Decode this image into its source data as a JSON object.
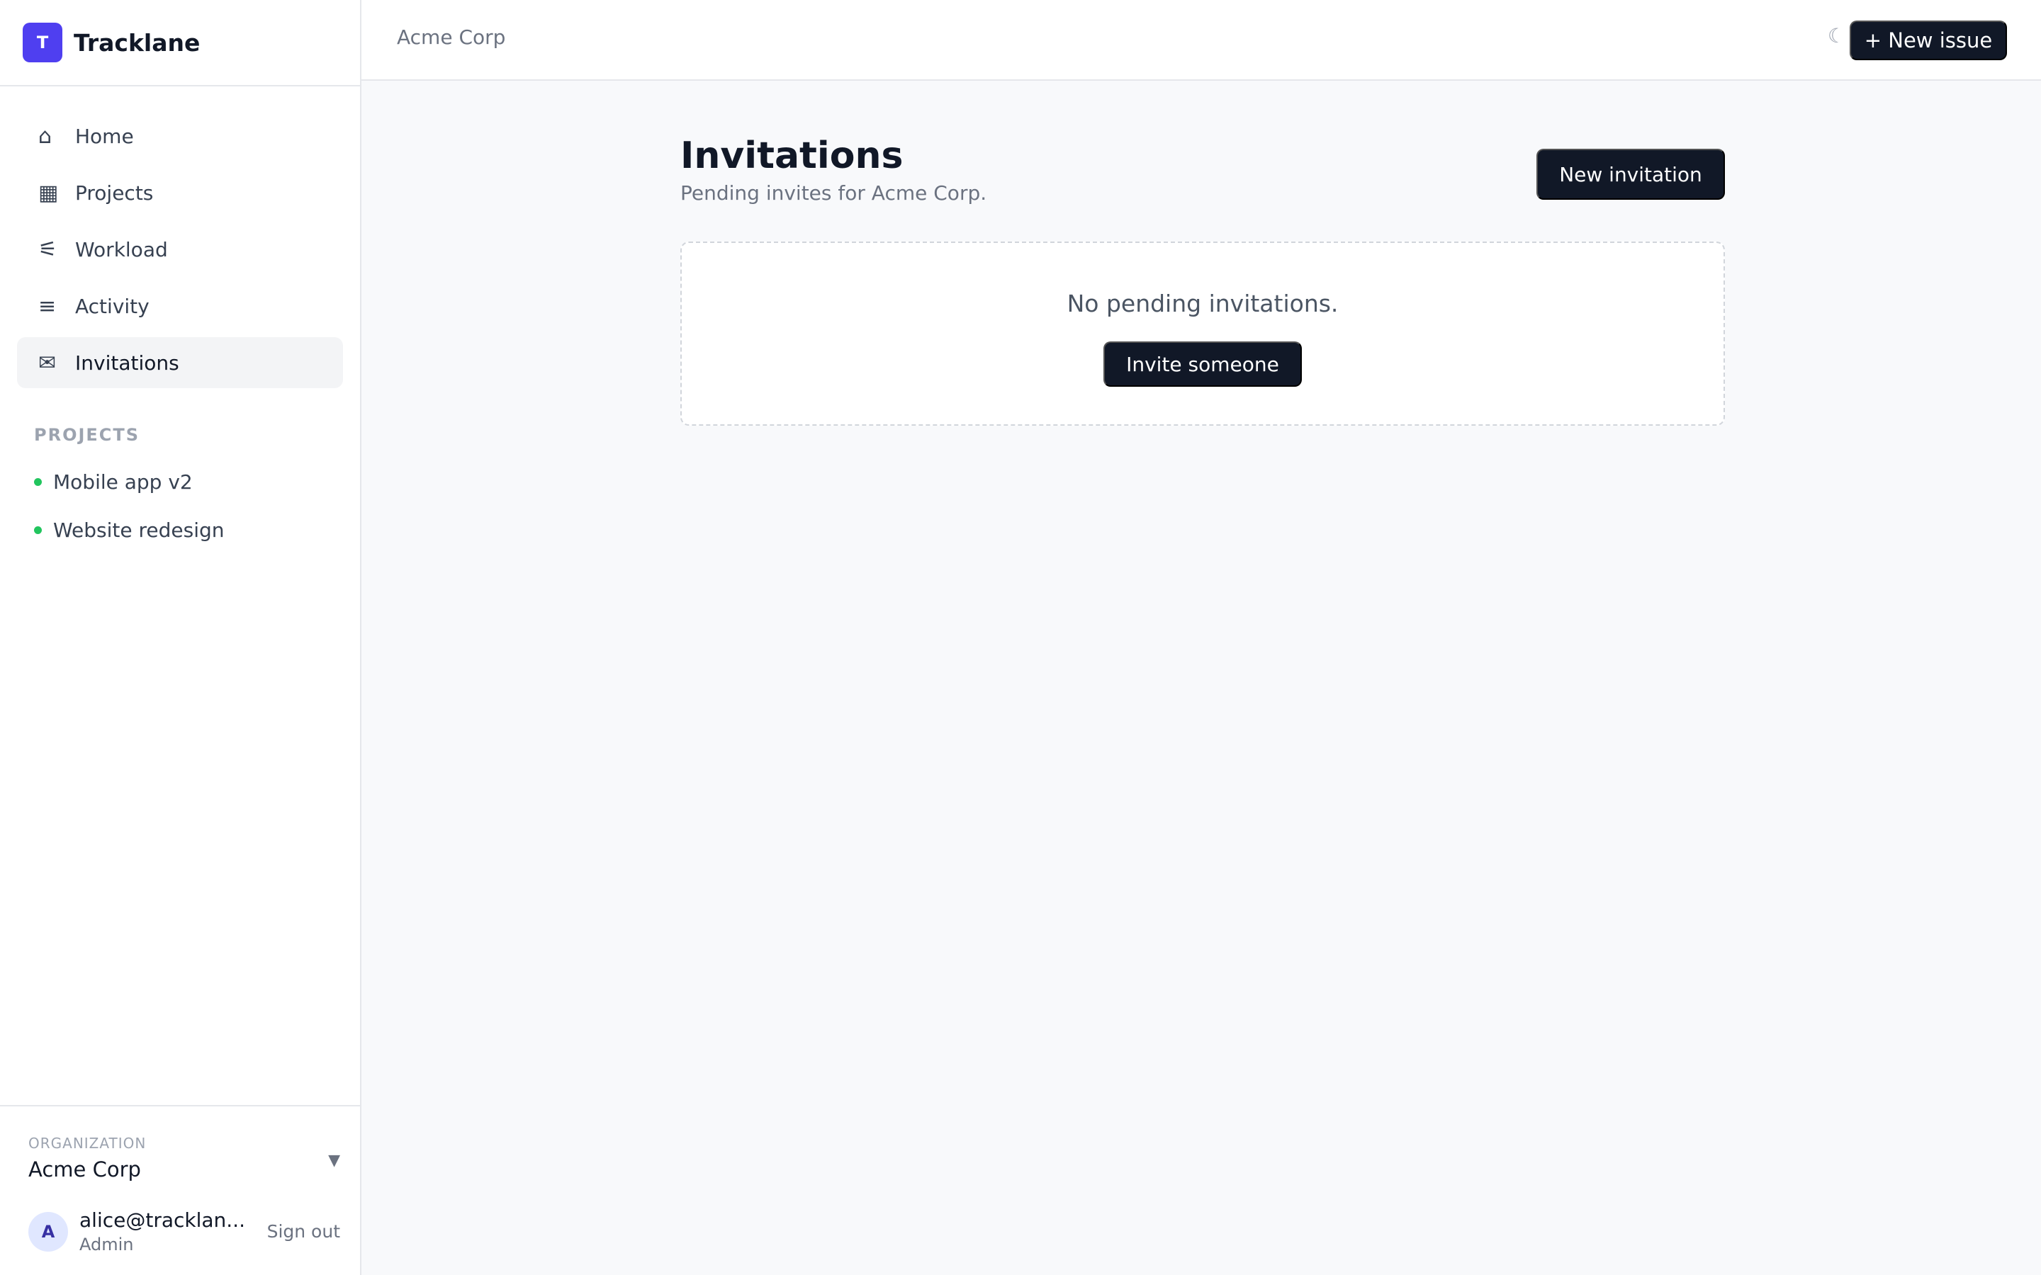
{
  "brand": {
    "logo_letter": "T",
    "name": "Tracklane",
    "color": "#4f3ff0"
  },
  "nav": [
    {
      "label": "Home",
      "icon": "⌂",
      "icon_name": "home-icon",
      "active": false
    },
    {
      "label": "Projects",
      "icon": "▦",
      "icon_name": "projects-icon",
      "active": false
    },
    {
      "label": "Workload",
      "icon": "⚟",
      "icon_name": "workload-icon",
      "active": false
    },
    {
      "label": "Activity",
      "icon": "≡",
      "icon_name": "activity-icon",
      "active": false
    },
    {
      "label": "Invitations",
      "icon": "✉",
      "icon_name": "mail-icon",
      "active": true
    }
  ],
  "projects_section": {
    "label": "PROJECTS",
    "items": [
      {
        "label": "Mobile app v2",
        "status_color": "#22c55e"
      },
      {
        "label": "Website redesign",
        "status_color": "#22c55e"
      }
    ]
  },
  "org": {
    "label": "ORGANIZATION",
    "name": "Acme Corp",
    "caret": "▼"
  },
  "user": {
    "avatar_letter": "A",
    "email": "alice@tracklan...",
    "role": "Admin",
    "signout_label": "Sign out"
  },
  "topbar": {
    "breadcrumb": "Acme Corp",
    "theme_icon": "☾",
    "new_issue_label": "+ New issue"
  },
  "page": {
    "title": "Invitations",
    "subtitle": "Pending invites for Acme Corp.",
    "new_invitation_label": "New invitation",
    "empty_text": "No pending invitations.",
    "invite_button_label": "Invite someone"
  }
}
